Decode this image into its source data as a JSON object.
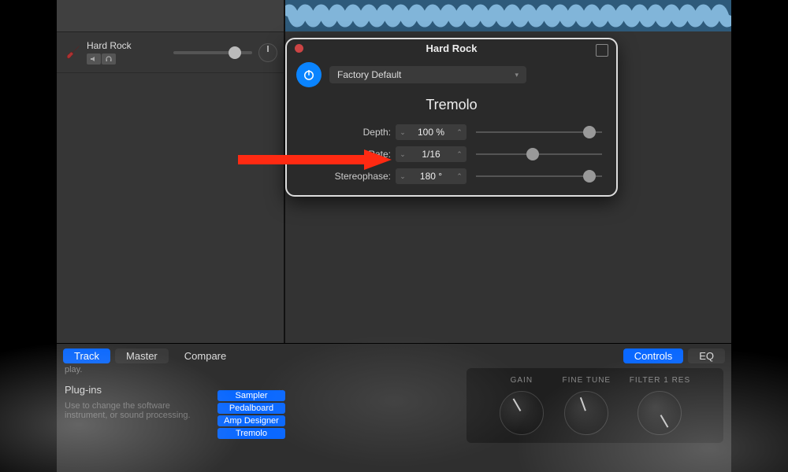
{
  "track": {
    "name": "Hard Rock",
    "volume_pct": 70
  },
  "plugin_panel": {
    "title": "Hard Rock",
    "preset": "Factory Default",
    "effect": "Tremolo",
    "params": [
      {
        "label": "Depth:",
        "value": "100 %",
        "slider_pct": 85
      },
      {
        "label": "Rate:",
        "value": "1/16",
        "slider_pct": 40
      },
      {
        "label": "Stereophase:",
        "value": "180 °",
        "slider_pct": 85
      }
    ]
  },
  "smart_controls": {
    "tabs_left": [
      "Track",
      "Master",
      "Compare"
    ],
    "tabs_right": [
      "Controls",
      "EQ"
    ],
    "truncated_text": "play.",
    "plugins_header": "Plug-ins",
    "plugins_desc": "Use to change the software instrument, or sound processing.",
    "plugin_chips": [
      "Sampler",
      "Pedalboard",
      "Amp Designer",
      "Tremolo"
    ],
    "knobs": [
      {
        "label": "GAIN"
      },
      {
        "label": "FINE TUNE"
      },
      {
        "label": "FILTER 1 RES"
      }
    ]
  },
  "annotation": {
    "points_to": "Rate:"
  }
}
